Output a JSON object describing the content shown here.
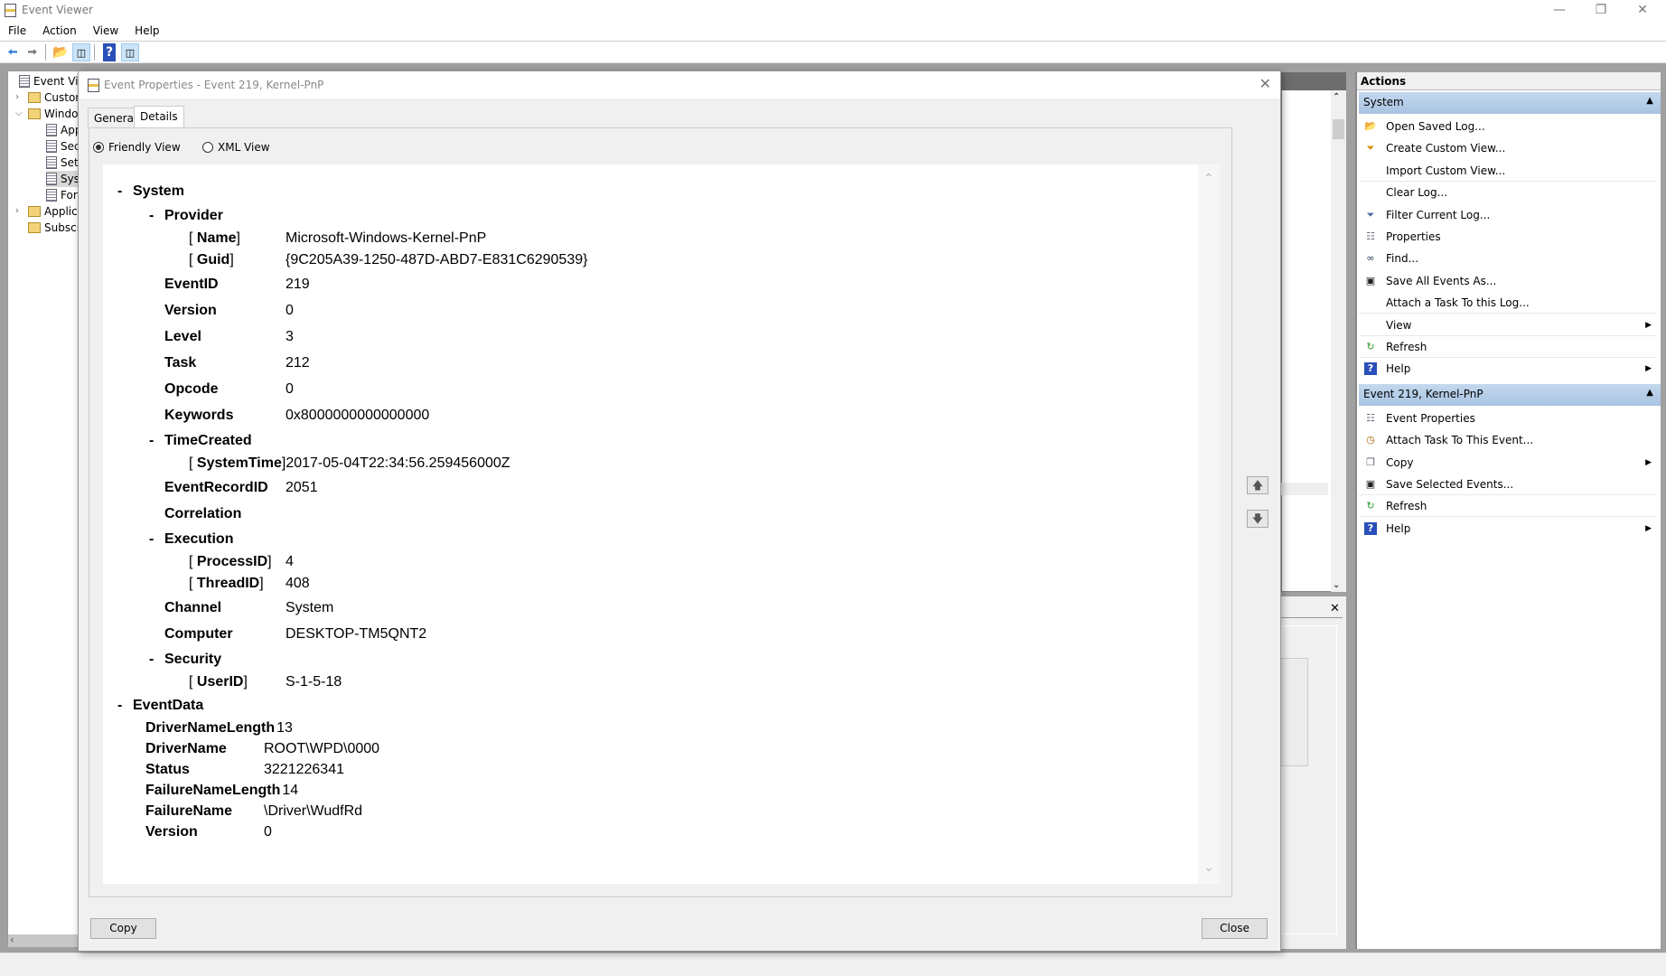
{
  "window": {
    "title": "Event Viewer",
    "controls": [
      "minimize",
      "restore",
      "close"
    ]
  },
  "menu": [
    "File",
    "Action",
    "View",
    "Help"
  ],
  "toolbar": [
    "back-icon",
    "forward-icon",
    "up-folder-icon",
    "show-hide-tree-icon",
    "help-icon",
    "show-hide-actions-icon"
  ],
  "tree": {
    "items": [
      {
        "label": "Event View",
        "depth": 0,
        "icon": "log"
      },
      {
        "label": "Custon",
        "depth": 1,
        "icon": "folder",
        "expander": "collapsed"
      },
      {
        "label": "Windo",
        "depth": 1,
        "icon": "folder",
        "expander": "expanded"
      },
      {
        "label": "App",
        "depth": 2,
        "icon": "log"
      },
      {
        "label": "Sec",
        "depth": 2,
        "icon": "log"
      },
      {
        "label": "Set",
        "depth": 2,
        "icon": "log"
      },
      {
        "label": "Sys",
        "depth": 2,
        "icon": "log",
        "selected": true
      },
      {
        "label": "For",
        "depth": 2,
        "icon": "log"
      },
      {
        "label": "Applica",
        "depth": 1,
        "icon": "folder",
        "expander": "collapsed"
      },
      {
        "label": "Subscri",
        "depth": 1,
        "icon": "folder"
      }
    ]
  },
  "dialog": {
    "title": "Event Properties - Event 219, Kernel-PnP",
    "tabs": [
      {
        "label": "General",
        "active": false
      },
      {
        "label": "Details",
        "active": true
      }
    ],
    "view_options": [
      {
        "label": "Friendly View",
        "checked": true
      },
      {
        "label": "XML View",
        "checked": false
      }
    ],
    "copy_label": "Copy",
    "close_label": "Close",
    "rows": [
      {
        "kind": "section",
        "level": 1,
        "label": "System"
      },
      {
        "kind": "section",
        "level": 2,
        "label": "Provider"
      },
      {
        "kind": "attr",
        "label": "Name",
        "value": "Microsoft-Windows-Kernel-PnP"
      },
      {
        "kind": "attr",
        "label": "Guid",
        "value": "{9C205A39-1250-487D-ABD7-E831C6290539}"
      },
      {
        "kind": "field",
        "label": "EventID",
        "value": "219"
      },
      {
        "kind": "field",
        "label": "Version",
        "value": "0"
      },
      {
        "kind": "field",
        "label": "Level",
        "value": "3"
      },
      {
        "kind": "field",
        "label": "Task",
        "value": "212"
      },
      {
        "kind": "field",
        "label": "Opcode",
        "value": "0"
      },
      {
        "kind": "field",
        "label": "Keywords",
        "value": "0x8000000000000000"
      },
      {
        "kind": "section",
        "level": 2,
        "label": "TimeCreated"
      },
      {
        "kind": "attr",
        "label": "SystemTime",
        "value": "2017-05-04T22:34:56.259456000Z"
      },
      {
        "kind": "field",
        "label": "EventRecordID",
        "value": "2051"
      },
      {
        "kind": "field",
        "label": "Correlation",
        "value": ""
      },
      {
        "kind": "section",
        "level": 2,
        "label": "Execution"
      },
      {
        "kind": "attr",
        "label": "ProcessID",
        "value": "4"
      },
      {
        "kind": "attr",
        "label": "ThreadID",
        "value": "408"
      },
      {
        "kind": "field",
        "label": "Channel",
        "value": "System"
      },
      {
        "kind": "field",
        "label": "Computer",
        "value": "DESKTOP-TM5QNT2"
      },
      {
        "kind": "section",
        "level": 2,
        "label": "Security"
      },
      {
        "kind": "attr",
        "label": "UserID",
        "value": "S-1-5-18"
      },
      {
        "kind": "section",
        "level": 1,
        "label": "EventData"
      },
      {
        "kind": "edata",
        "label": "DriverNameLength",
        "value": "13"
      },
      {
        "kind": "edata",
        "label": "DriverName",
        "value": "ROOT\\WPD\\0000"
      },
      {
        "kind": "edata",
        "label": "Status",
        "value": "3221226341"
      },
      {
        "kind": "edata",
        "label": "FailureNameLength",
        "value": "14"
      },
      {
        "kind": "edata",
        "label": "FailureName",
        "value": "\\Driver\\WudfRd"
      },
      {
        "kind": "edata",
        "label": "Version",
        "value": "0"
      }
    ]
  },
  "actions": {
    "title": "Actions",
    "sections": [
      {
        "title": "System",
        "items": [
          {
            "label": "Open Saved Log...",
            "icon": "open-folder-icon"
          },
          {
            "label": "Create Custom View...",
            "icon": "funnel-icon"
          },
          {
            "label": "Import Custom View...",
            "icon": "",
            "divider": true
          },
          {
            "label": "Clear Log...",
            "icon": ""
          },
          {
            "label": "Filter Current Log...",
            "icon": "filter-icon"
          },
          {
            "label": "Properties",
            "icon": "properties-icon"
          },
          {
            "label": "Find...",
            "icon": "binoculars-icon"
          },
          {
            "label": "Save All Events As...",
            "icon": "save-icon"
          },
          {
            "label": "Attach a Task To this Log...",
            "icon": "",
            "divider": true
          },
          {
            "label": "View",
            "icon": "",
            "submenu": true,
            "divider": true
          },
          {
            "label": "Refresh",
            "icon": "refresh-icon",
            "divider": true
          },
          {
            "label": "Help",
            "icon": "help-icon",
            "submenu": true
          }
        ]
      },
      {
        "title": "Event 219, Kernel-PnP",
        "items": [
          {
            "label": "Event Properties",
            "icon": "properties-icon"
          },
          {
            "label": "Attach Task To This Event...",
            "icon": "task-clock-icon"
          },
          {
            "label": "Copy",
            "icon": "copy-icon",
            "submenu": true
          },
          {
            "label": "Save Selected Events...",
            "icon": "save-icon",
            "divider": true
          },
          {
            "label": "Refresh",
            "icon": "refresh-icon",
            "divider": true
          },
          {
            "label": "Help",
            "icon": "help-icon",
            "submenu": true
          }
        ]
      }
    ]
  }
}
